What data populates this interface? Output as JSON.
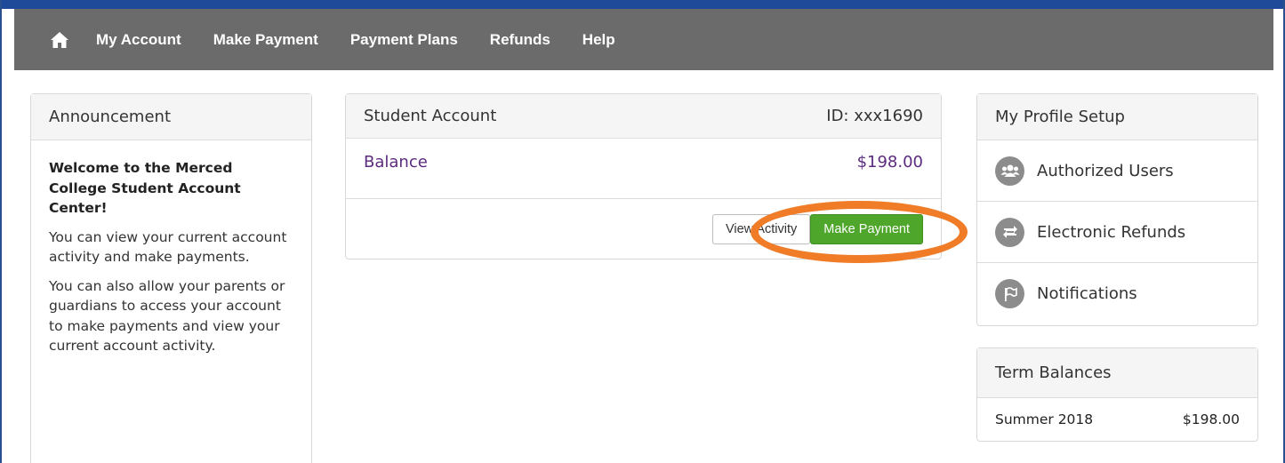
{
  "nav": {
    "home_icon": "home-icon",
    "items": [
      {
        "label": "My Account"
      },
      {
        "label": "Make Payment"
      },
      {
        "label": "Payment Plans"
      },
      {
        "label": "Refunds"
      },
      {
        "label": "Help"
      }
    ]
  },
  "announcement": {
    "title": "Announcement",
    "welcome": "Welcome to the Merced College Student Account Center!",
    "paragraphs": [
      "You can view your current account activity and make payments.",
      "You can also allow your parents or guardians to access your account to make payments and view your current account activity."
    ]
  },
  "account": {
    "title": "Student Account",
    "id_label": "ID: xxx1690",
    "balance_label": "Balance",
    "balance_value": "$198.00",
    "view_activity": "View Activity",
    "make_payment": "Make Payment"
  },
  "profile": {
    "title": "My Profile Setup",
    "items": [
      {
        "label": "Authorized Users",
        "icon": "users-icon"
      },
      {
        "label": "Electronic Refunds",
        "icon": "refund-icon"
      },
      {
        "label": "Notifications",
        "icon": "flag-icon"
      }
    ]
  },
  "terms": {
    "title": "Term Balances",
    "rows": [
      {
        "term": "Summer 2018",
        "amount": "$198.00"
      }
    ]
  },
  "colors": {
    "nav_bg": "#6b6b6b",
    "accent_purple": "#5b2b7e",
    "primary_green": "#4ea72b",
    "highlight_orange": "#f07c28"
  }
}
